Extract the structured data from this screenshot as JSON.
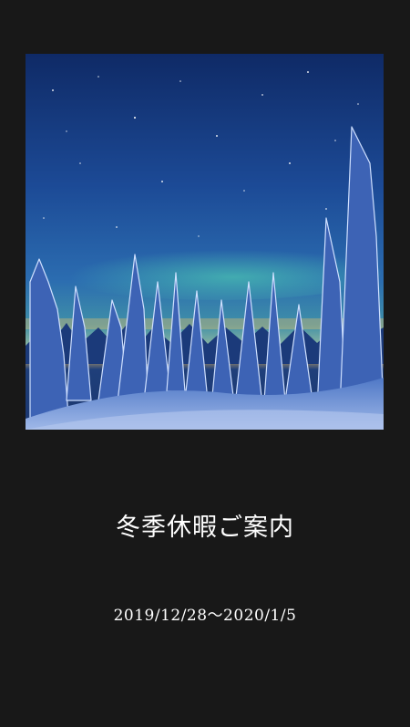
{
  "background_color": "#181818",
  "hero_image": {
    "subject": "snow-covered forest under night sky with aurora"
  },
  "notice": {
    "title": "冬季休暇ご案内",
    "dates": "2019/12/28〜2020/1/5"
  }
}
